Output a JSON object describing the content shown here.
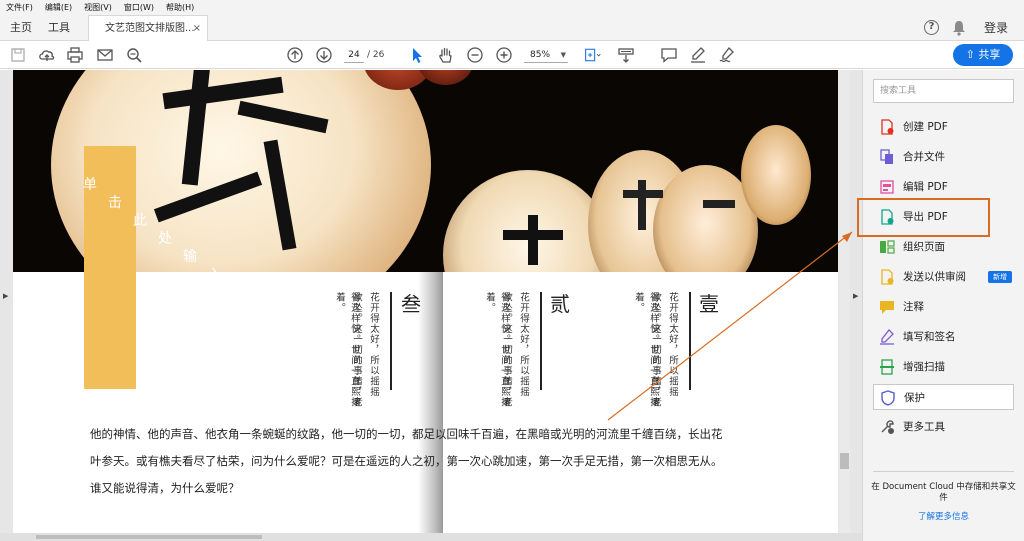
{
  "menubar": {
    "items": [
      "文件(F)",
      "编辑(E)",
      "视图(V)",
      "窗口(W)",
      "帮助(H)"
    ]
  },
  "tabs": {
    "home": "主页",
    "tools": "工具",
    "doc": "文艺范图文排版图...",
    "close": "×",
    "login": "登录"
  },
  "toolbar": {
    "page_current": "24",
    "page_total": "/ 26",
    "zoom": "85%",
    "share": "共享"
  },
  "document": {
    "vertical_title": [
      "单",
      "击",
      "此",
      "处",
      "输",
      "入"
    ],
    "poems": [
      {
        "head": "壹",
        "col1": "花开得太好，所以摇摇",
        "col2": "欲坠。这一切的事情，老",
        "col3": "得这样快。世间一直熙攘着。"
      },
      {
        "head": "贰",
        "col1": "花开得太好，所以摇摇",
        "col2": "欲坠。这一切的事情，老",
        "col3": "得这样快。世间一直熙攘着。"
      },
      {
        "head": "叁",
        "col1": "花开得太好，所以摇摇",
        "col2": "欲坠。这一切的事情，老",
        "col3": "得这样快。世间一直熙攘着。"
      }
    ],
    "paragraph_lines": [
      "他的神情、他的声音、他衣角一条蜿蜒的纹路，他一切的一切，都足以回味千百遍，在黑暗或光明的河流里千缠百绕，长出花",
      "叶参天。或有樵夫看尽了枯荣，问为什么爱呢？可是在遥远的人之初，第一次心跳加速，第一次手足无措，第一次相思无从。",
      "谁又能说得清，为什么爱呢？"
    ]
  },
  "right_pane": {
    "search_placeholder": "搜索工具",
    "tools": [
      {
        "label": "创建 PDF",
        "icon": "create-pdf-icon",
        "color": "#e0301e"
      },
      {
        "label": "合并文件",
        "icon": "combine-files-icon",
        "color": "#6d5dd3"
      },
      {
        "label": "编辑 PDF",
        "icon": "edit-pdf-icon",
        "color": "#e34f9f"
      },
      {
        "label": "导出 PDF",
        "icon": "export-pdf-icon",
        "color": "#0fa88f"
      },
      {
        "label": "组织页面",
        "icon": "organize-pages-icon",
        "color": "#48a942"
      },
      {
        "label": "发送以供审阅",
        "icon": "send-review-icon",
        "color": "#e8b623"
      },
      {
        "label": "注释",
        "icon": "comment-icon",
        "color": "#e8b623"
      },
      {
        "label": "填写和签名",
        "icon": "fill-sign-icon",
        "color": "#7b5cd6"
      },
      {
        "label": "增强扫描",
        "icon": "enhance-scan-icon",
        "color": "#2aa54a"
      },
      {
        "label": "保护",
        "icon": "protect-icon",
        "color": "#5b5fc7"
      },
      {
        "label": "更多工具",
        "icon": "more-tools-icon",
        "color": "#555555"
      }
    ],
    "new_badge": "新增",
    "cloud_text": "在 Document Cloud 中存储和共享文件",
    "cloud_link": "了解更多信息"
  },
  "colors": {
    "accent": "#1473e6",
    "annotation": "#d86c22",
    "title_bar_gold": "#f1be5a"
  }
}
